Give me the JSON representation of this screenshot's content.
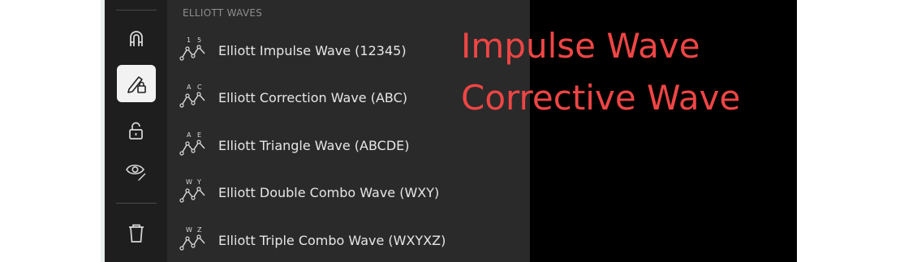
{
  "panel": {
    "heading": "ELLIOTT WAVES",
    "items": [
      {
        "label": "Elliott Impulse Wave (12345)",
        "icon_start": "1",
        "icon_end": "5"
      },
      {
        "label": "Elliott Correction Wave (ABC)",
        "icon_start": "A",
        "icon_end": "C"
      },
      {
        "label": "Elliott Triangle Wave (ABCDE)",
        "icon_start": "A",
        "icon_end": "E"
      },
      {
        "label": "Elliott Double Combo Wave (WXY)",
        "icon_start": "W",
        "icon_end": "Y"
      },
      {
        "label": "Elliott Triple Combo Wave (WXYXZ)",
        "icon_start": "W",
        "icon_end": "Z"
      }
    ]
  },
  "annotations": {
    "line1": "Impulse Wave",
    "line2": "Corrective Wave"
  },
  "toolbar": {
    "icons": [
      "magnet-icon",
      "lock-drawing-icon",
      "unlock-icon",
      "eye-drawing-icon",
      "trash-icon"
    ]
  },
  "colors": {
    "annotation": "#f04545",
    "panel_bg": "#2a2a2a",
    "toolbar_bg": "#1e1e1e",
    "active_button_bg": "#f2f2f2"
  }
}
